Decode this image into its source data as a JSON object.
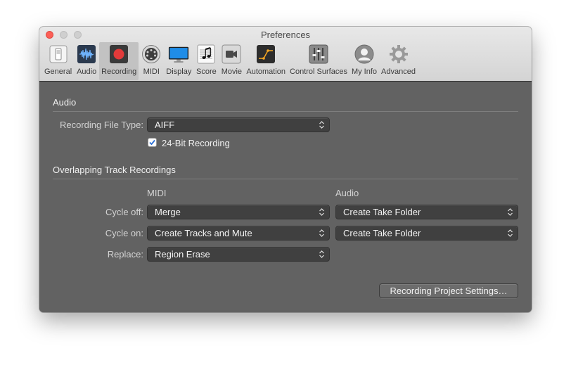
{
  "window": {
    "title": "Preferences"
  },
  "toolbar": {
    "items": [
      {
        "label": "General",
        "icon": "general-switch-icon"
      },
      {
        "label": "Audio",
        "icon": "audio-waveform-icon"
      },
      {
        "label": "Recording",
        "icon": "record-button-icon",
        "active": true
      },
      {
        "label": "MIDI",
        "icon": "midi-port-icon"
      },
      {
        "label": "Display",
        "icon": "display-monitor-icon"
      },
      {
        "label": "Score",
        "icon": "score-notation-icon"
      },
      {
        "label": "Movie",
        "icon": "movie-camera-icon"
      },
      {
        "label": "Automation",
        "icon": "automation-curve-icon"
      },
      {
        "label": "Control Surfaces",
        "icon": "control-surface-faders-icon"
      },
      {
        "label": "My Info",
        "icon": "user-avatar-icon"
      },
      {
        "label": "Advanced",
        "icon": "gear-icon"
      }
    ]
  },
  "audio_section": {
    "title": "Audio",
    "file_type_label": "Recording File Type:",
    "file_type_value": "AIFF",
    "bit_depth_label": "24-Bit Recording",
    "bit_depth_checked": true
  },
  "overlap_section": {
    "title": "Overlapping Track Recordings",
    "midi_header": "MIDI",
    "audio_header": "Audio",
    "rows": [
      {
        "label": "Cycle off:",
        "midi": "Merge",
        "audio": "Create Take Folder"
      },
      {
        "label": "Cycle on:",
        "midi": "Create Tracks and Mute",
        "audio": "Create Take Folder"
      },
      {
        "label": "Replace:",
        "midi": "Region Erase"
      }
    ]
  },
  "project_settings_button": "Recording Project Settings…",
  "colors": {
    "record_red": "#e23a3a",
    "checkbox_blue": "#2a6fd6",
    "panel_gray": "#626262"
  }
}
